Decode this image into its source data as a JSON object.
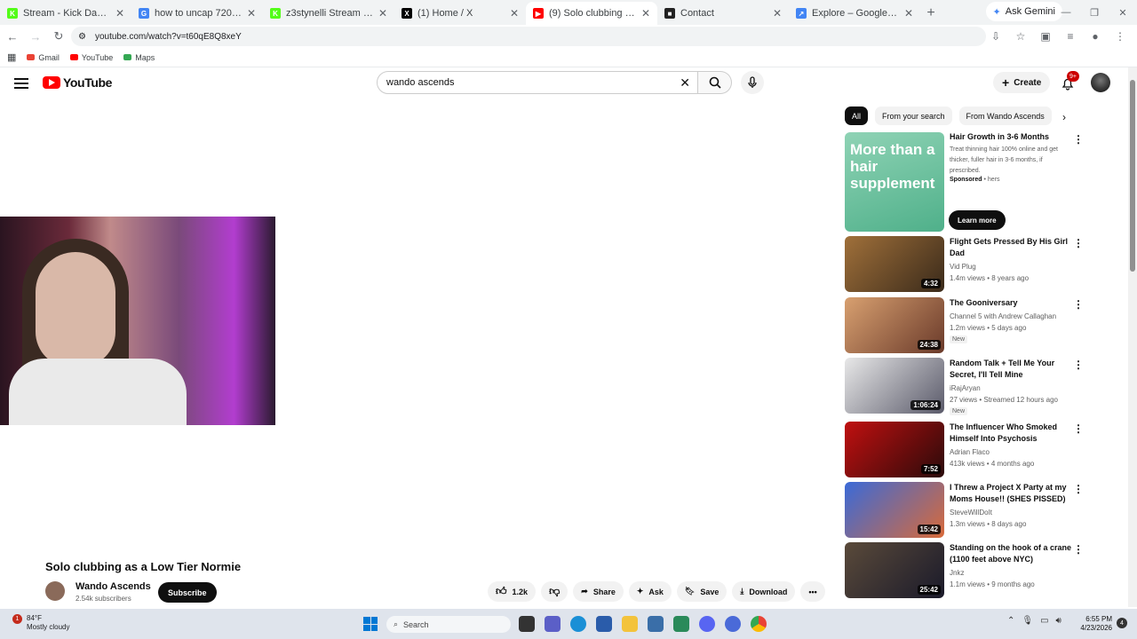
{
  "browser": {
    "tabs": [
      {
        "title": "Stream - Kick Dashboard",
        "color": "#53fc18",
        "glyph": "K"
      },
      {
        "title": "how to uncap 720 on kick st",
        "color": "#4285f4",
        "glyph": "G"
      },
      {
        "title": "z3stynelli Stream - Watch Li",
        "color": "#53fc18",
        "glyph": "K"
      },
      {
        "title": "(1) Home / X",
        "color": "#000000",
        "glyph": "X"
      },
      {
        "title": "(9) Solo clubbing as a Low T",
        "color": "#ff0000",
        "glyph": "▶",
        "active": true
      },
      {
        "title": "Contact",
        "color": "#222222",
        "glyph": "■"
      },
      {
        "title": "Explore – Google Trends",
        "color": "#4285f4",
        "glyph": "↗"
      }
    ],
    "ask_gemini": "Ask Gemini",
    "url": "youtube.com/watch?v=t60qE8Q8xeY",
    "bookmarks": [
      {
        "label": "Gmail",
        "color": "#ea4335"
      },
      {
        "label": "YouTube",
        "color": "#ff0000"
      },
      {
        "label": "Maps",
        "color": "#34a853"
      }
    ]
  },
  "youtube": {
    "logo": "YouTube",
    "search_value": "wando ascends",
    "create": "Create",
    "notif_count": "9+",
    "video": {
      "title": "Solo clubbing as a Low Tier Normie",
      "channel": "Wando Ascends",
      "subscribers": "2.54k subscribers",
      "subscribe": "Subscribe",
      "likes": "1.2k",
      "share": "Share",
      "ask": "Ask",
      "save": "Save",
      "download": "Download"
    },
    "chips": [
      "All",
      "From your search",
      "From Wando Ascends"
    ],
    "ad": {
      "thumb_text": "More than a hair supplement",
      "title": "Hair Growth in 3-6 Months",
      "desc": "Treat thinning hair 100% online and get thicker, fuller hair in 3-6 months, if prescribed.",
      "sponsored": "Sponsored",
      "advertiser": "hers",
      "cta": "Learn more"
    },
    "recommendations": [
      {
        "title": "Flight Gets Pressed By His Girl Dad",
        "channel": "Vid Plug",
        "stats": "1.4m views • 8 years ago",
        "duration": "4:32",
        "colors": [
          "#a0703a",
          "#3a2a1a"
        ]
      },
      {
        "title": "The Gooniversary",
        "channel": "Channel 5 with Andrew Callaghan",
        "stats": "1.2m views • 5 days ago",
        "duration": "24:38",
        "badge": "New",
        "colors": [
          "#d8a070",
          "#6a3a2a"
        ]
      },
      {
        "title": "Random Talk + Tell Me Your Secret, I'll Tell Mine",
        "channel": "iRajAryan",
        "stats": "27 views • Streamed 12 hours ago",
        "duration": "1:06:24",
        "badge": "New",
        "colors": [
          "#e8e8e8",
          "#5a5a6a"
        ]
      },
      {
        "title": "The Influencer Who Smoked Himself Into Psychosis",
        "channel": "Adrian Flaco",
        "stats": "413k views • 4 months ago",
        "duration": "7:52",
        "colors": [
          "#c01010",
          "#2a0a0a"
        ]
      },
      {
        "title": "I Threw a Project X Party at my Moms House!! (SHES PISSED)",
        "channel": "SteveWillDoIt",
        "stats": "1.3m views • 8 days ago",
        "duration": "15:42",
        "colors": [
          "#3a6ad8",
          "#d86a3a"
        ]
      },
      {
        "title": "Standing on the hook of a crane (1100 feet above NYC)",
        "channel": "Jnkz",
        "stats": "1.1m views • 9 months ago",
        "duration": "25:42",
        "colors": [
          "#5a4a3a",
          "#1a1a2a"
        ]
      }
    ]
  },
  "taskbar": {
    "temp": "84°F",
    "weather": "Mostly cloudy",
    "search": "Search",
    "time": "6:55 PM",
    "date": "4/23/2026",
    "notifications": "4"
  }
}
